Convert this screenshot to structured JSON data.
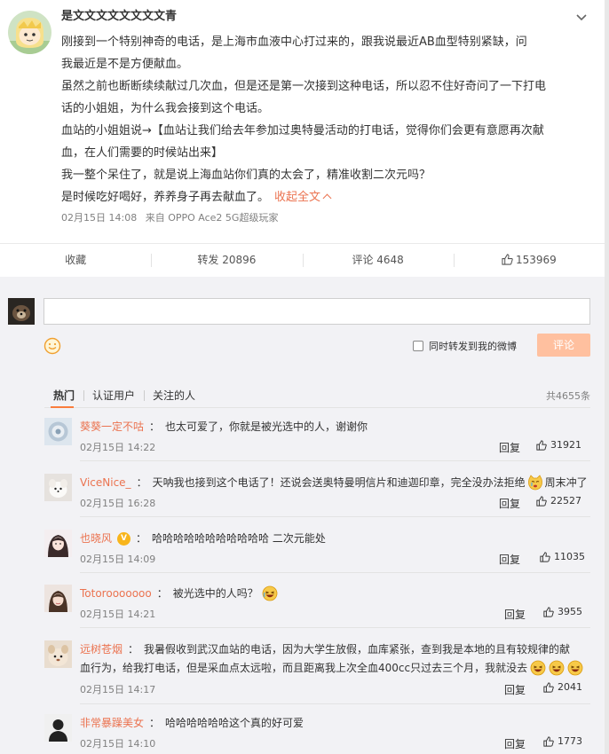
{
  "post": {
    "username": "是文文文文文文文文青",
    "lines": [
      "刚接到一个特别神奇的电话，是上海市血液中心打过来的，跟我说最近AB血型特别紧缺，问",
      "我最近是不是方便献血。",
      "虽然之前也断断续续献过几次血，但是还是第一次接到这种电话，所以忍不住好奇问了一下打电",
      "话的小姐姐，为什么我会接到这个电话。",
      "血站的小姐姐说→【血站让我们给去年参加过奥特曼活动的打电话，觉得你们会更有意愿再次献",
      "血，在人们需要的时候站出来】",
      "我一整个呆住了，就是说上海血站你们真的太会了，精准收割二次元吗？",
      "是时候吃好喝好，养养身子再去献血了。"
    ],
    "collapse_label": "收起全文",
    "time": "02月15日 14:08",
    "source": "来自 OPPO Ace2 5G超级玩家"
  },
  "actions": {
    "favorite": "收藏",
    "repost": "转发 20896",
    "comment": "评论 4648",
    "like": "153969"
  },
  "composer": {
    "input_value": "",
    "repost_label": "同时转发到我的微博",
    "submit_label": "评论"
  },
  "tabs": {
    "items": [
      "热门",
      "认证用户",
      "关注的人"
    ],
    "total": "共4655条"
  },
  "comments": [
    {
      "name": "葵葵一定不咕",
      "text": "也太可爱了，你就是被光选中的人，谢谢你",
      "time": "02月15日 14:22",
      "reply": "回复",
      "likes": "31921"
    },
    {
      "name": "ViceNice_",
      "text": "天呐我也接到这个电话了！还说会送奥特曼明信片和迪迦印章，完全没办法拒绝",
      "text_after": "周末冲了",
      "time": "02月15日 16:28",
      "reply": "回复",
      "likes": "22527"
    },
    {
      "name": "也晓风",
      "text": "哈哈哈哈哈哈哈哈哈哈哈 二次元能处",
      "time": "02月15日 14:09",
      "reply": "回复",
      "likes": "11035"
    },
    {
      "name": "Totorooooooo",
      "text": "被光选中的人吗？",
      "time": "02月15日 14:21",
      "reply": "回复",
      "likes": "3955"
    },
    {
      "name": "远树苍烟",
      "text": "我暑假收到武汉血站的电话，因为大学生放假，血库紧张，查到我是本地的且有较规律的献",
      "text2": "血行为，给我打电话，但是采血点太远啦，而且距离我上次全血400cc只过去三个月，我就没去",
      "time": "02月15日 14:17",
      "reply": "回复",
      "likes": "2041"
    },
    {
      "name": "非常暴躁美女",
      "text": "哈哈哈哈哈哈这个真的好可爱",
      "time": "02月15日 14:10",
      "reply": "回复",
      "likes": "1773"
    }
  ]
}
